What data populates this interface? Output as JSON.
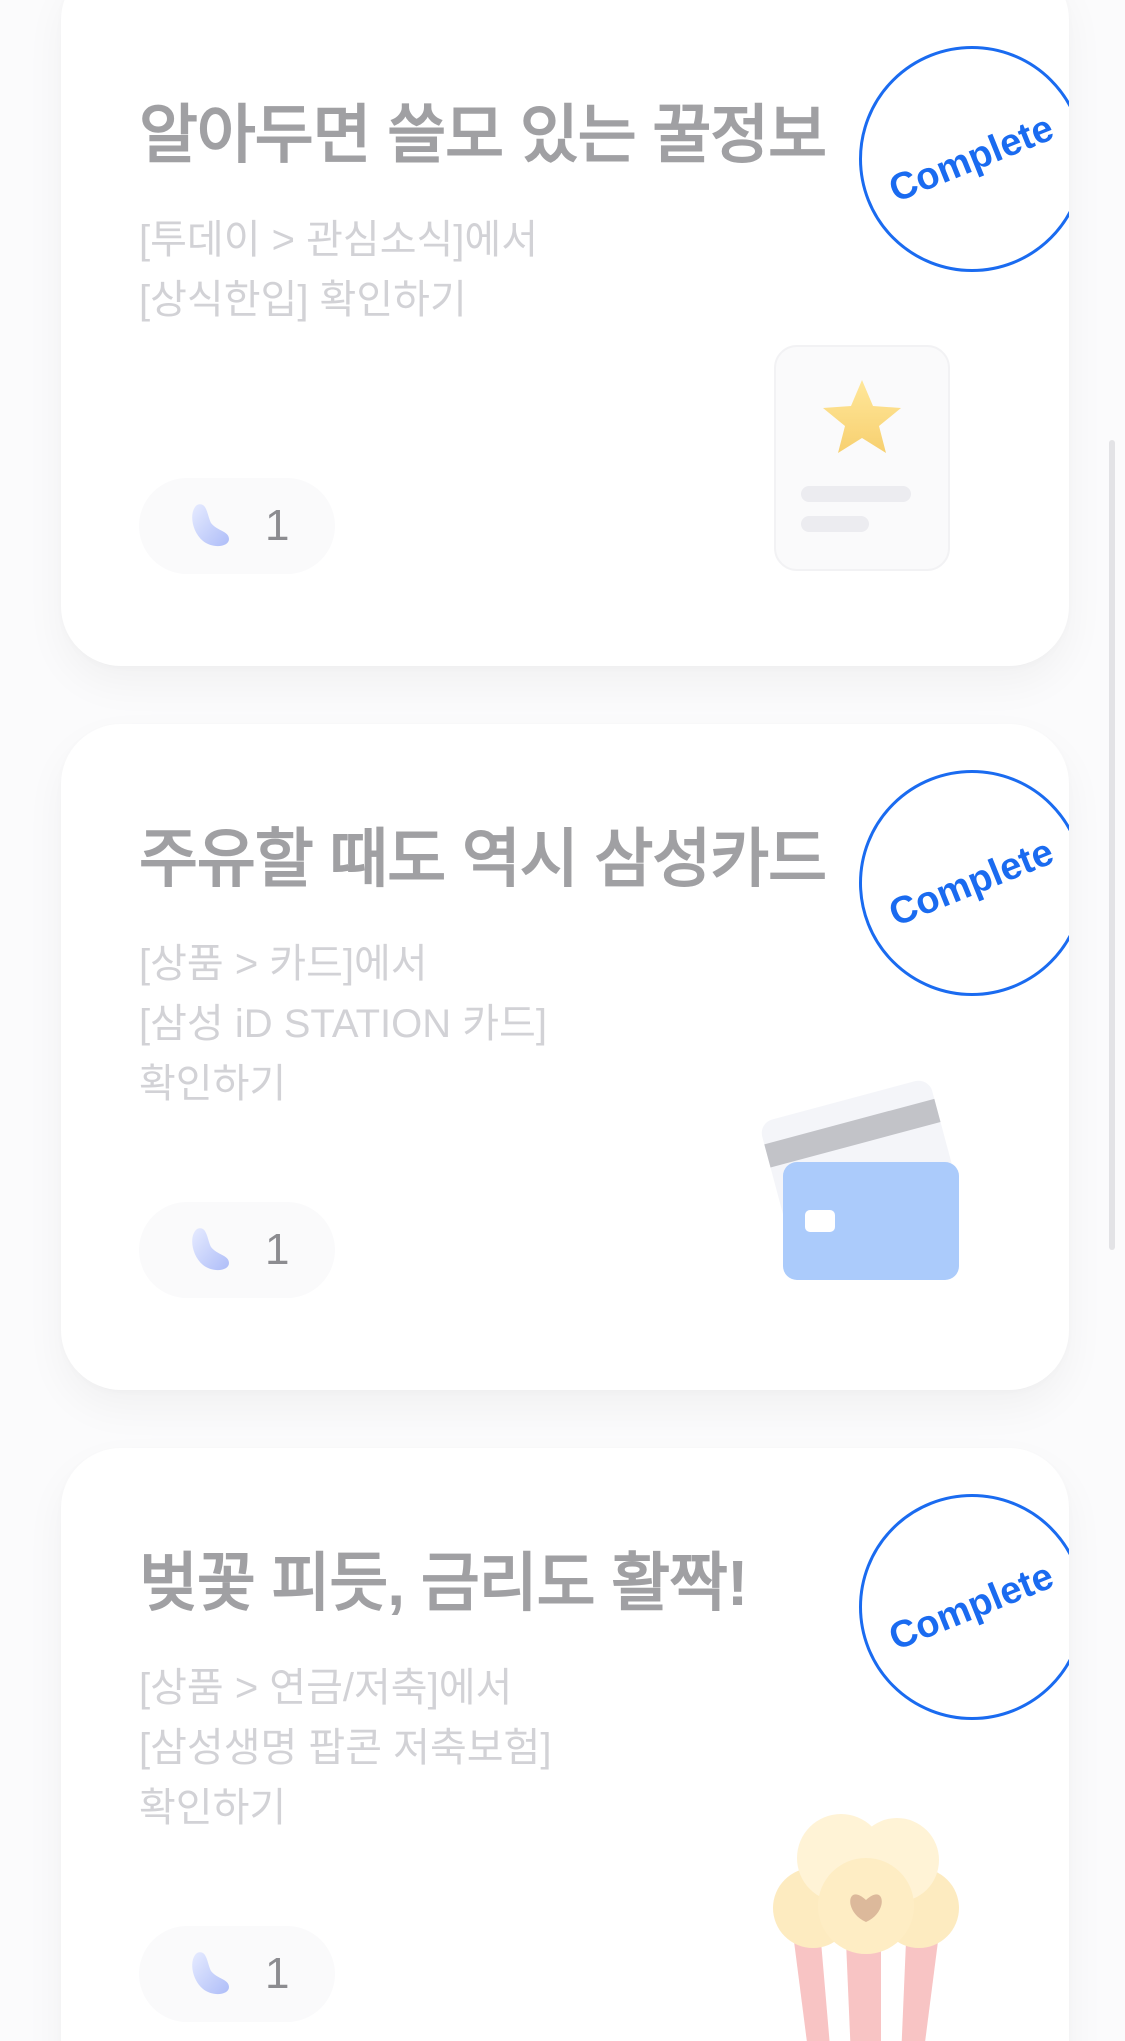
{
  "missions": [
    {
      "title": "알아두면 쓸모 있는 꿀정보",
      "desc": [
        "[투데이 > 관심소식]에서",
        "[상식한입] 확인하기"
      ],
      "reward_count": "1",
      "status": "Complete",
      "icon": "starred-document-icon"
    },
    {
      "title": "주유할 때도 역시 삼성카드",
      "desc": [
        "[상품 > 카드]에서",
        "[삼성 iD STATION 카드]",
        "확인하기"
      ],
      "reward_count": "1",
      "status": "Complete",
      "icon": "credit-card-icon"
    },
    {
      "title": "벚꽃 피듯, 금리도 활짝!",
      "desc": [
        "[상품 > 연금/저축]에서",
        "[삼성생명 팝콘 저축보험]",
        "확인하기"
      ],
      "reward_count": "1",
      "status": "Complete",
      "icon": "popcorn-icon"
    }
  ],
  "colors": {
    "stamp": "#1a6bf0",
    "title": "#a0a0a3",
    "desc": "#d2d2d6",
    "card_bg": "#ffffff",
    "page_bg": "#fbfbfc"
  }
}
